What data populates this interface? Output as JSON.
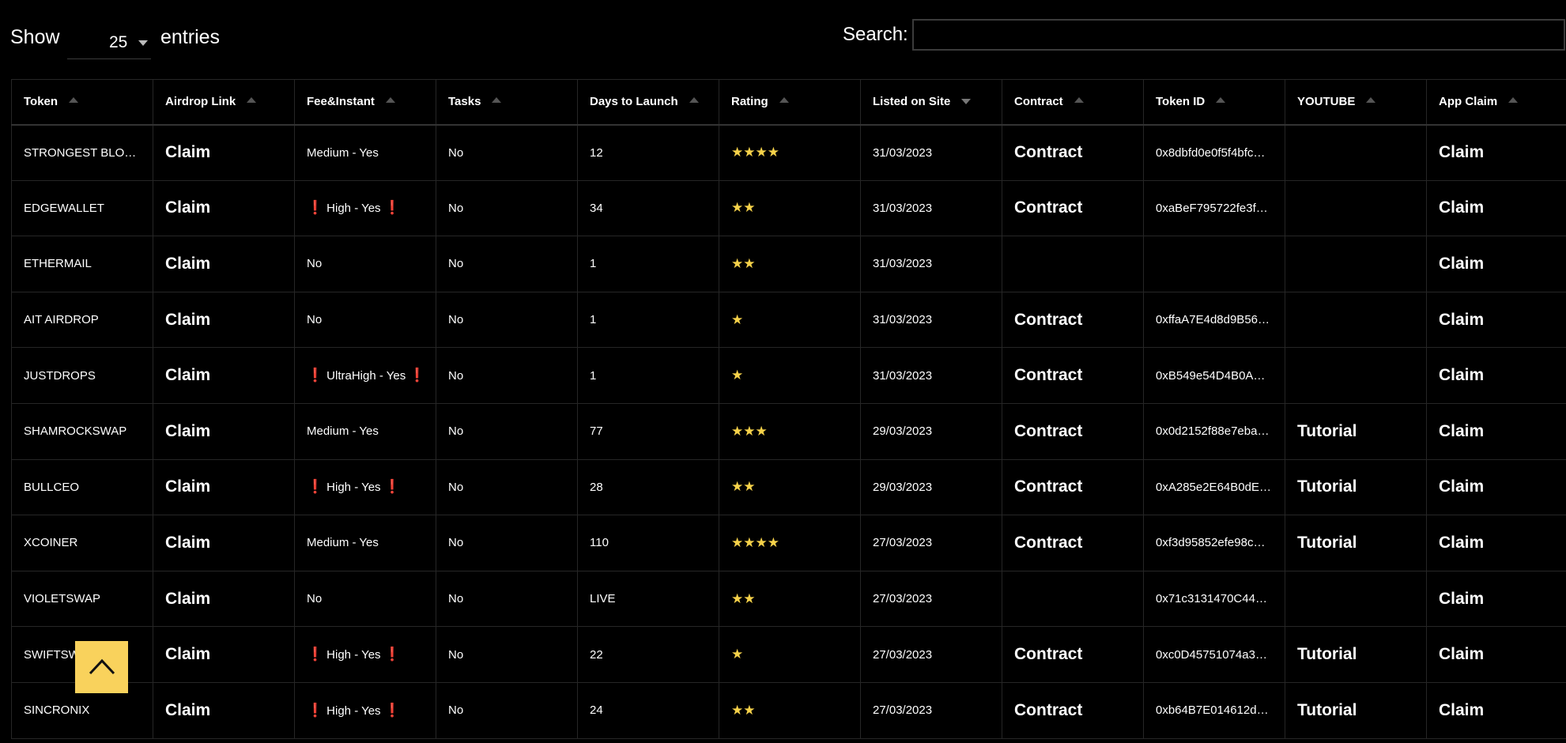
{
  "controls": {
    "show_label": "Show",
    "page_length": "25",
    "entries_label": "entries",
    "search_label": "Search:",
    "search_value": ""
  },
  "colors": {
    "background": "#000000",
    "star": "#f6d24a",
    "warning": "#e01010",
    "back_to_top": "#f9d25c"
  },
  "columns": [
    {
      "label": "Token",
      "sort": "asc"
    },
    {
      "label": "Airdrop Link",
      "sort": "asc"
    },
    {
      "label": "Fee&Instant",
      "sort": "asc"
    },
    {
      "label": "Tasks",
      "sort": "asc"
    },
    {
      "label": "Days to Launch",
      "sort": "asc"
    },
    {
      "label": "Rating",
      "sort": "asc"
    },
    {
      "label": "Listed on Site",
      "sort": "desc"
    },
    {
      "label": "Contract",
      "sort": "asc"
    },
    {
      "label": "Token ID",
      "sort": "asc"
    },
    {
      "label": "YOUTUBE",
      "sort": "asc"
    },
    {
      "label": "App Claim",
      "sort": "asc"
    }
  ],
  "rows": [
    {
      "token": "STRONGEST BLO…",
      "airdrop": "Claim",
      "fee": "Medium - Yes",
      "fee_warn": false,
      "tasks": "No",
      "days": "12",
      "rating": 4,
      "listed": "31/03/2023",
      "contract": "Contract",
      "token_id": "0x8dbfd0e0f5f4bfc…",
      "youtube": "",
      "app_claim": "Claim"
    },
    {
      "token": "EDGEWALLET",
      "airdrop": "Claim",
      "fee": "High - Yes",
      "fee_warn": true,
      "tasks": "No",
      "days": "34",
      "rating": 2,
      "listed": "31/03/2023",
      "contract": "Contract",
      "token_id": "0xaBeF795722fe3f…",
      "youtube": "",
      "app_claim": "Claim"
    },
    {
      "token": "ETHERMAIL",
      "airdrop": "Claim",
      "fee": "No",
      "fee_warn": false,
      "tasks": "No",
      "days": "1",
      "rating": 2,
      "listed": "31/03/2023",
      "contract": "",
      "token_id": "",
      "youtube": "",
      "app_claim": "Claim"
    },
    {
      "token": "AIT AIRDROP",
      "airdrop": "Claim",
      "fee": "No",
      "fee_warn": false,
      "tasks": "No",
      "days": "1",
      "rating": 1,
      "listed": "31/03/2023",
      "contract": "Contract",
      "token_id": "0xffaA7E4d8d9B56…",
      "youtube": "",
      "app_claim": "Claim"
    },
    {
      "token": "JUSTDROPS",
      "airdrop": "Claim",
      "fee": "UltraHigh - Yes",
      "fee_warn": true,
      "tasks": "No",
      "days": "1",
      "rating": 1,
      "listed": "31/03/2023",
      "contract": "Contract",
      "token_id": "0xB549e54D4B0A…",
      "youtube": "",
      "app_claim": "Claim"
    },
    {
      "token": "SHAMROCKSWAP",
      "airdrop": "Claim",
      "fee": "Medium - Yes",
      "fee_warn": false,
      "tasks": "No",
      "days": "77",
      "rating": 3,
      "listed": "29/03/2023",
      "contract": "Contract",
      "token_id": "0x0d2152f88e7eba…",
      "youtube": "Tutorial",
      "app_claim": "Claim"
    },
    {
      "token": "BULLCEO",
      "airdrop": "Claim",
      "fee": "High - Yes",
      "fee_warn": true,
      "tasks": "No",
      "days": "28",
      "rating": 2,
      "listed": "29/03/2023",
      "contract": "Contract",
      "token_id": "0xA285e2E64B0dE…",
      "youtube": "Tutorial",
      "app_claim": "Claim"
    },
    {
      "token": "XCOINER",
      "airdrop": "Claim",
      "fee": "Medium - Yes",
      "fee_warn": false,
      "tasks": "No",
      "days": "110",
      "rating": 4,
      "listed": "27/03/2023",
      "contract": "Contract",
      "token_id": "0xf3d95852efe98c…",
      "youtube": "Tutorial",
      "app_claim": "Claim"
    },
    {
      "token": "VIOLETSWAP",
      "airdrop": "Claim",
      "fee": "No",
      "fee_warn": false,
      "tasks": "No",
      "days": "LIVE",
      "rating": 2,
      "listed": "27/03/2023",
      "contract": "",
      "token_id": "0x71c3131470C44…",
      "youtube": "",
      "app_claim": "Claim"
    },
    {
      "token": "SWIFTSW",
      "airdrop": "Claim",
      "fee": "High - Yes",
      "fee_warn": true,
      "tasks": "No",
      "days": "22",
      "rating": 1,
      "listed": "27/03/2023",
      "contract": "Contract",
      "token_id": "0xc0D45751074a3…",
      "youtube": "Tutorial",
      "app_claim": "Claim"
    },
    {
      "token": "SINCRONIX",
      "airdrop": "Claim",
      "fee": "High - Yes",
      "fee_warn": true,
      "tasks": "No",
      "days": "24",
      "rating": 2,
      "listed": "27/03/2023",
      "contract": "Contract",
      "token_id": "0xb64B7E014612d…",
      "youtube": "Tutorial",
      "app_claim": "Claim"
    }
  ],
  "warning_glyph": "❗",
  "star_glyph": "★",
  "back_to_top_icon": "chevron-up-icon"
}
